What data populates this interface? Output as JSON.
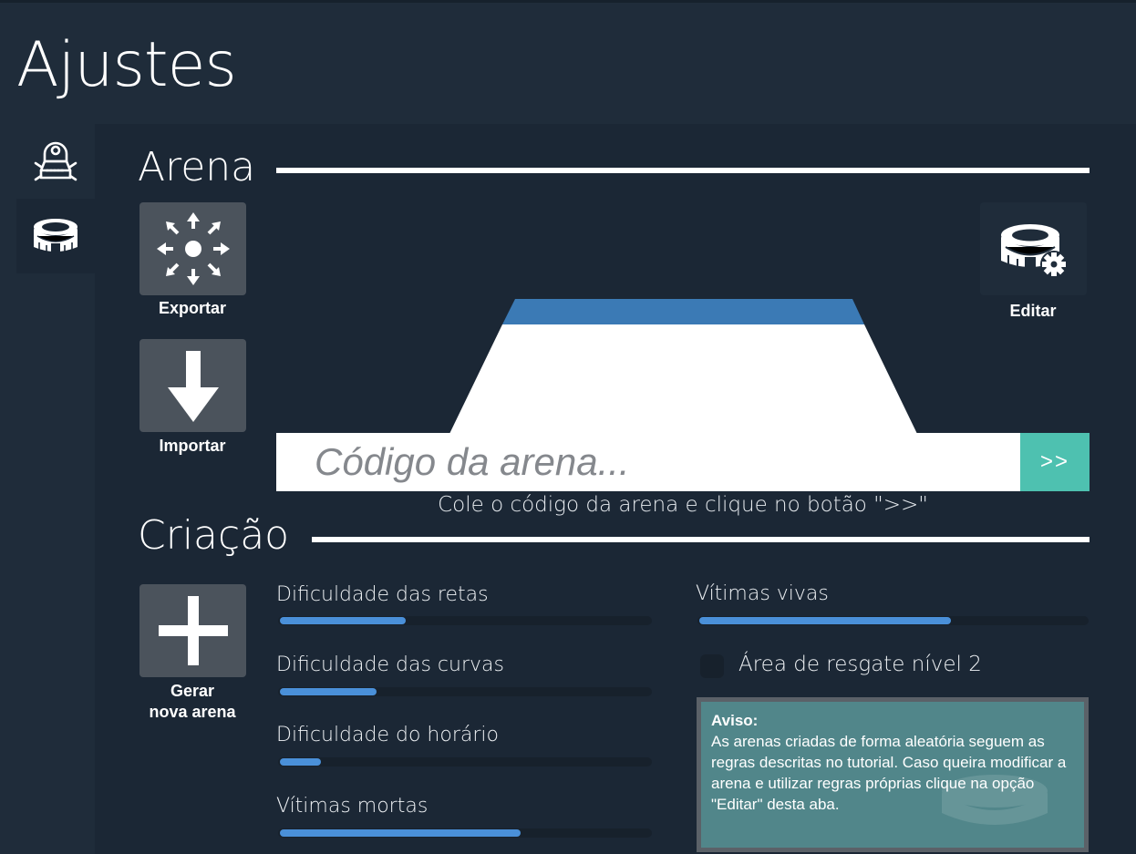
{
  "header": {
    "title": "Ajustes"
  },
  "sidebar": {
    "items": [
      {
        "icon": "robot-icon",
        "active": false
      },
      {
        "icon": "stadium-icon",
        "active": true
      }
    ]
  },
  "arena": {
    "section_title": "Arena",
    "export_label": "Exportar",
    "import_label": "Importar",
    "edit_label": "Editar",
    "code_placeholder": "Código da arena...",
    "go_label": ">>",
    "hint": "Cole o código da arena e clique no botão \">>\""
  },
  "creation": {
    "section_title": "Criação",
    "generate_label_line1": "Gerar",
    "generate_label_line2": "nova arena",
    "sliders": [
      {
        "label": "Dificuldade das retas",
        "value": 0.34
      },
      {
        "label": "Dificuldade das curvas",
        "value": 0.26
      },
      {
        "label": "Dificuldade do horário",
        "value": 0.11
      },
      {
        "label": "Vítimas mortas",
        "value": 0.65
      },
      {
        "label": "Vítimas vivas",
        "value": 0.65
      }
    ],
    "rescue_checkbox_label": "Área de resgate nível 2",
    "rescue_checked": false,
    "notice_title": "Aviso:",
    "notice_text": "As arenas criadas de forma aleatória seguem as regras descritas no tutorial. Caso queira modificar a arena e utilizar regras próprias clique na opção \"Editar\" desta aba."
  },
  "colors": {
    "background": "#1f2c3a",
    "panel": "#1b2735",
    "accent": "#4a90d9",
    "go_button": "#4ec1b0",
    "notice": "#51868a"
  }
}
